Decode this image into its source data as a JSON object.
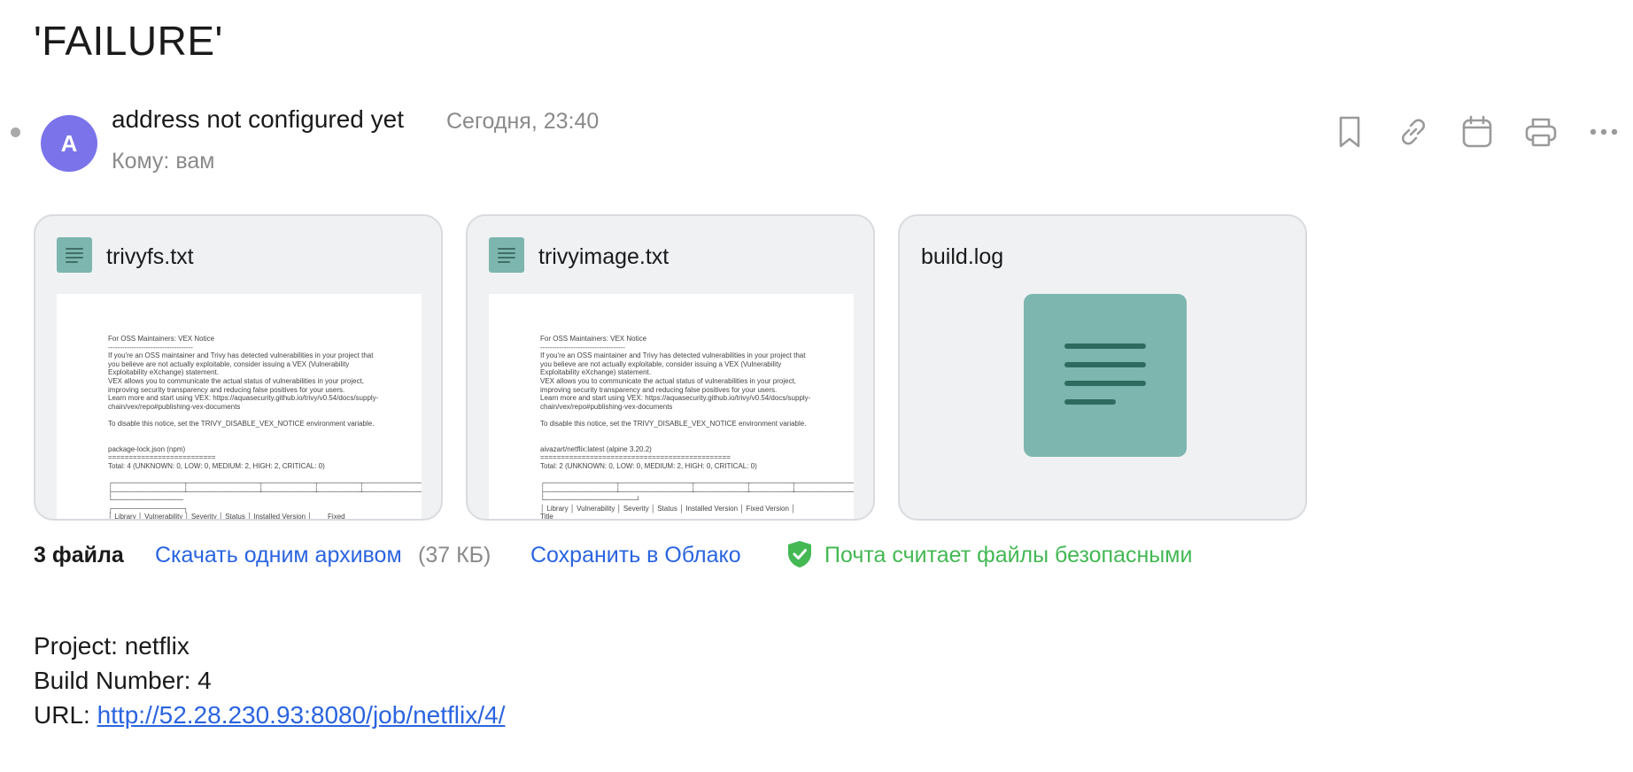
{
  "email": {
    "subject": "'FAILURE'",
    "avatar_letter": "A",
    "sender": "address not configured yet",
    "date": "Сегодня, 23:40",
    "recipient": "Кому: вам"
  },
  "toolbar": {
    "icons": [
      "bookmark-icon",
      "link-icon",
      "calendar-icon",
      "print-icon",
      "more-icon"
    ]
  },
  "attachments": {
    "files": [
      {
        "name": "trivyfs.txt",
        "preview": "For OSS Maintainers: VEX Notice\n------------------------------------\nIf you're an OSS maintainer and Trivy has detected vulnerabilities in your project that\nyou believe are not actually exploitable, consider issuing a VEX (Vulnerability\nExploitability eXchange) statement.\nVEX allows you to communicate the actual status of vulnerabilities in your project,\nimproving security transparency and reducing false positives for your users.\nLearn more and start using VEX: https://aquasecurity.github.io/trivy/v0.54/docs/supply-\nchain/vex/repo#publishing-vex-documents\n\nTo disable this notice, set the TRIVY_DISABLE_VEX_NOTICE environment variable.\n\n\npackage-lock.json (npm)\n==========================\nTotal: 4 (UNKNOWN: 0, LOW: 0, MEDIUM: 2, HIGH: 2, CRITICAL: 0)\n\n┌──────────────┬──────────────┬──────────┬────────┬─────────────┬───────\n├──────────────┴──────────────┴──────────┴────────┴─────────────┴───────\n└──────────────\n┌──────────────┐\n│ Library │ Vulnerability │ Severity │ Status │ Installed Version │        Fixed"
      },
      {
        "name": "trivyimage.txt",
        "preview": "For OSS Maintainers: VEX Notice\n------------------------------------\nIf you're an OSS maintainer and Trivy has detected vulnerabilities in your project that\nyou believe are not actually exploitable, consider issuing a VEX (Vulnerability\nExploitability eXchange) statement.\nVEX allows you to communicate the actual status of vulnerabilities in your project,\nimproving security transparency and reducing false positives for your users.\nLearn more and start using VEX: https://aquasecurity.github.io/trivy/v0.54/docs/supply-\nchain/vex/repo#publishing-vex-documents\n\nTo disable this notice, set the TRIVY_DISABLE_VEX_NOTICE environment variable.\n\n\naivazart/netflix:latest (alpine 3.20.2)\n==============================================\nTotal: 2 (UNKNOWN: 0, LOW: 0, MEDIUM: 2, HIGH: 0, CRITICAL: 0)\n\n┌──────────────┬──────────────┬──────────┬────────┬─────────────┬────────\n├──────────────┴──────────────┴──────────┴────────┴─────────────┴────────\n└──────────────────┘\n│ Library │ Vulnerability │ Severity │ Status │ Installed Version │ Fixed Version │\nTitle"
      },
      {
        "name": "build.log",
        "preview": ""
      }
    ],
    "count_label": "3 файла",
    "download_label": "Скачать одним архивом",
    "download_size": "(37 КБ)",
    "save_cloud_label": "Сохранить в Облако",
    "safe_label": "Почта считает файлы безопасными",
    "safe_color": "#43b853"
  },
  "body": {
    "project_line": "Project: netflix",
    "build_line": "Build Number: 4",
    "url_label": "URL: ",
    "url": "http://52.28.230.93:8080/job/netflix/4/"
  }
}
